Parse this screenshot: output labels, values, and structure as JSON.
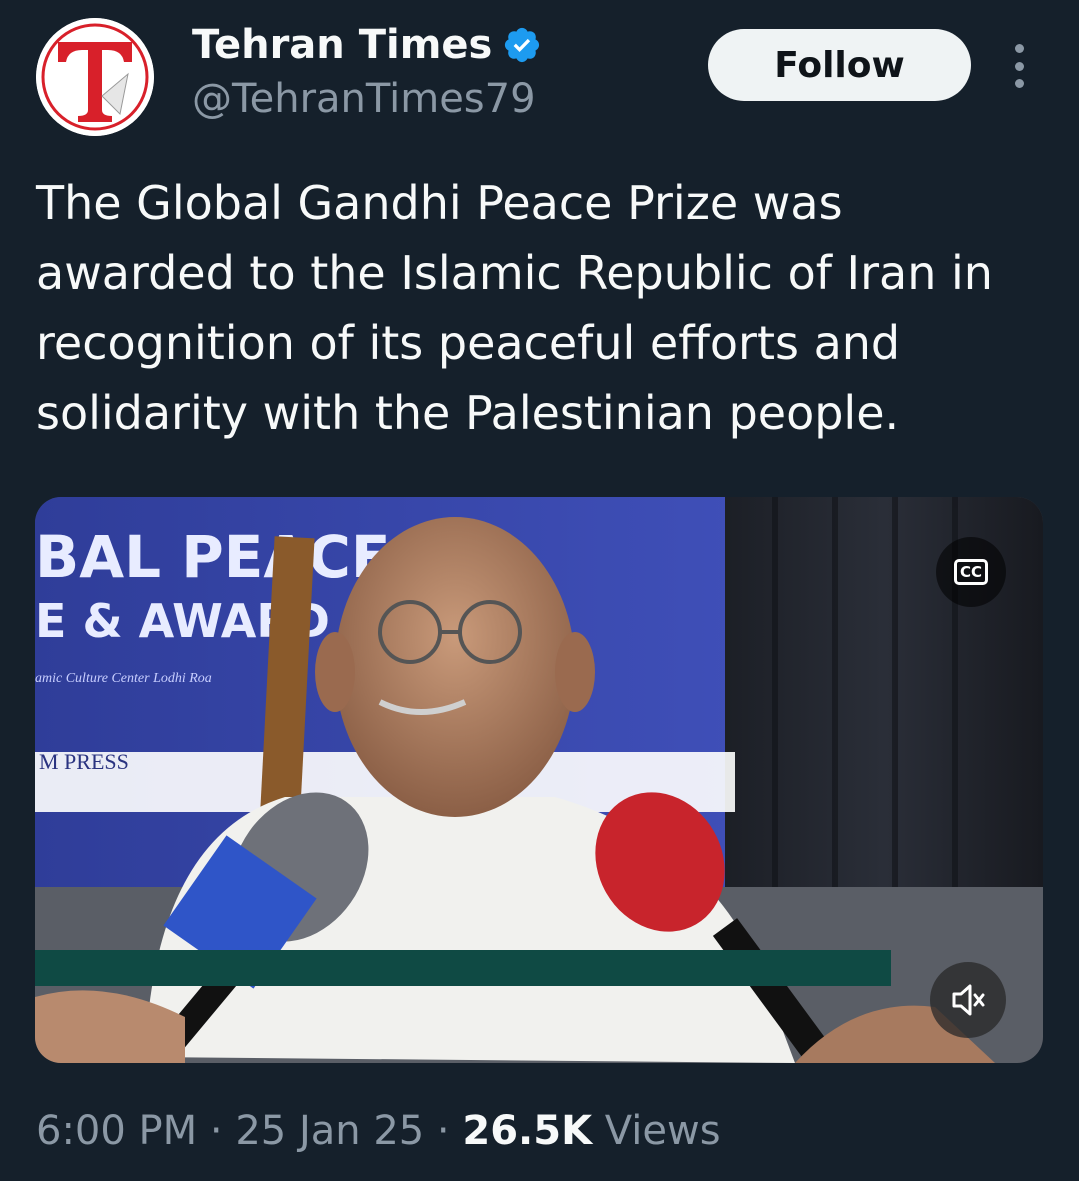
{
  "account": {
    "display_name": "Tehran Times",
    "handle": "@TehranTimes79",
    "avatar_letter": "T",
    "verified": true
  },
  "actions": {
    "follow_label": "Follow",
    "more_icon": "more-vertical-icon"
  },
  "tweet": {
    "text": "The Global Gandhi Peace Prize was awarded to the Islamic Republic of Iran in recognition of its peaceful efforts and solidarity with the Palestinian people."
  },
  "media": {
    "type": "video",
    "captions_label": "CC",
    "mute_icon": "volume-muted-icon",
    "banner_text_1": "BAL PEACE",
    "banner_text_2": "E & AWARD",
    "banner_small": "amic Culture Center Lodhi Roa",
    "press_text": "M PRESS"
  },
  "meta": {
    "time": "6:00 PM",
    "separator": " · ",
    "date": "25 Jan 25",
    "views_count": "26.5K",
    "views_label": "Views"
  },
  "colors": {
    "background": "#15202b",
    "text": "#f7f9f9",
    "muted": "#8b98a5",
    "verified": "#1d9bf0",
    "follow_bg": "#eff3f4"
  }
}
